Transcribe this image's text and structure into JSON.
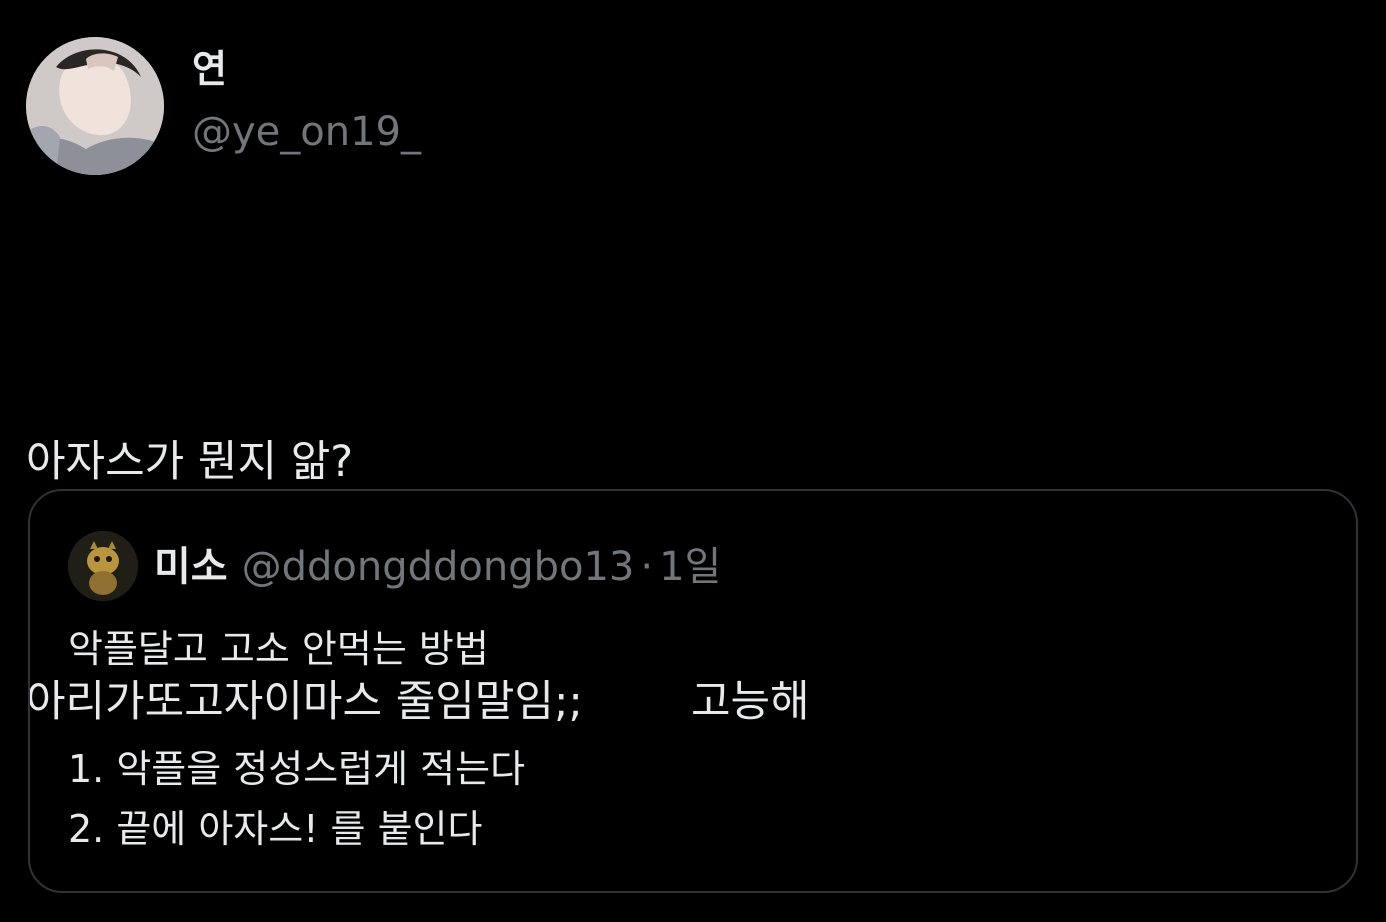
{
  "tweet": {
    "author_name": "연",
    "author_handle": "@ye_on19_",
    "avatar_icon": "profile-photo-icon",
    "text_lines": [
      "아자스가 뭔지 앎?",
      "아리가또고자이마스 줄임말임;;",
      "고능해"
    ]
  },
  "quote": {
    "author_name": "미소",
    "author_handle": "@ddongddongbo13",
    "separator": "·",
    "time": "1일",
    "avatar_icon": "profile-photo-icon",
    "text_lines": [
      "악플달고 고소 안먹는 방법",
      "",
      "1. 악플을 정성스럽게 적는다",
      "2. 끝에 아자스! 를 붙인다"
    ]
  },
  "colors": {
    "background": "#000000",
    "primary_text": "#e7e9ea",
    "secondary_text": "#71767b",
    "border": "#2f3336"
  }
}
